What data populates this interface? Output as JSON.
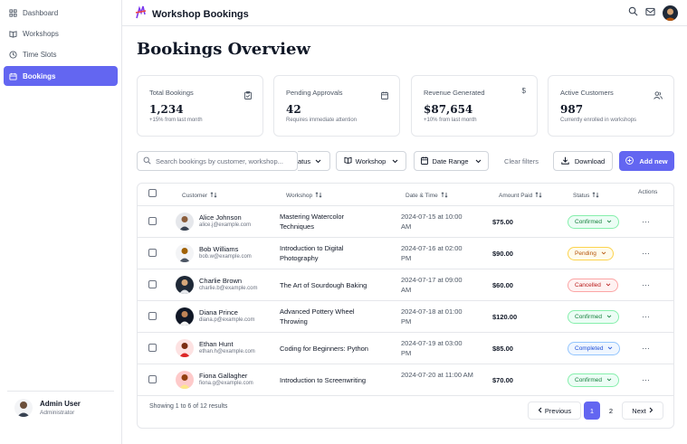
{
  "sidebar": {
    "items": [
      {
        "label": "Dashboard",
        "icon": "grid-icon"
      },
      {
        "label": "Workshops",
        "icon": "book-icon"
      },
      {
        "label": "Time Slots",
        "icon": "clock-icon"
      },
      {
        "label": "Bookings",
        "icon": "calendar-icon",
        "active": true
      }
    ],
    "user": {
      "name": "Admin User",
      "role": "Administrator"
    }
  },
  "header": {
    "title": "Workshop Bookings",
    "icons": [
      "search-icon",
      "mail-icon",
      "avatar"
    ]
  },
  "page": {
    "title": "Bookings Overview"
  },
  "stats": [
    {
      "label": "Total Bookings",
      "value": "1,234",
      "sub": "+15% from last month",
      "icon": "clipboard-icon"
    },
    {
      "label": "Pending Approvals",
      "value": "42",
      "sub": "Requires immediate attention",
      "icon": "calendar-icon"
    },
    {
      "label": "Revenue Generated",
      "value": "$87,654",
      "sub": "+10% from last month",
      "icon": "dollar-icon"
    },
    {
      "label": "Active Customers",
      "value": "987",
      "sub": "Currently enrolled in workshops",
      "icon": "users-icon"
    }
  ],
  "filters": {
    "search_placeholder": "Search bookings by customer, workshop...",
    "status_label": "atus",
    "workshop_label": "Workshop",
    "date_range_label": "Date Range",
    "clear_label": "Clear filters",
    "download_label": "Download",
    "add_label": "Add new"
  },
  "table": {
    "headers": {
      "customer": "Customer",
      "workshop": "Workshop",
      "datetime": "Date & Time",
      "amount": "Amount Paid",
      "status": "Status",
      "actions": "Actions"
    },
    "rows": [
      {
        "name": "Alice Johnson",
        "email": "alice.j@example.com",
        "workshop": "Mastering Watercolor Techniques",
        "datetime": "2024-07-15 at 10:00 AM",
        "amount": "$75.00",
        "status": "Confirmed",
        "status_key": "confirmed",
        "avatar_color": "#d1d5db"
      },
      {
        "name": "Bob Williams",
        "email": "bob.w@example.com",
        "workshop": "Introduction to Digital Photography",
        "datetime": "2024-07-16 at 02:00 PM",
        "amount": "$90.00",
        "status": "Pending",
        "status_key": "pending",
        "avatar_color": "#e5e7eb"
      },
      {
        "name": "Charlie Brown",
        "email": "charlie.b@example.com",
        "workshop": "The Art of Sourdough Baking",
        "datetime": "2024-07-17 at 09:00 AM",
        "amount": "$60.00",
        "status": "Cancelled",
        "status_key": "cancelled",
        "avatar_color": "#1f2937"
      },
      {
        "name": "Diana Prince",
        "email": "diana.p@example.com",
        "workshop": "Advanced Pottery Wheel Throwing",
        "datetime": "2024-07-18 at 01:00 PM",
        "amount": "$120.00",
        "status": "Confirmed",
        "status_key": "confirmed",
        "avatar_color": "#111827"
      },
      {
        "name": "Ethan Hunt",
        "email": "ethan.h@example.com",
        "workshop": "Coding for Beginners: Python",
        "datetime": "2024-07-19 at 03:00 PM",
        "amount": "$85.00",
        "status": "Completed",
        "status_key": "completed",
        "avatar_color": "#fde2e2"
      },
      {
        "name": "Fiona Gallagher",
        "email": "fiona.g@example.com",
        "workshop": "Introduction to Screenwriting",
        "datetime": "2024-07-20 at 11:00 AM",
        "amount": "$70.00",
        "status": "Confirmed",
        "status_key": "confirmed",
        "avatar_color": "#fecaca"
      }
    ],
    "footer": {
      "showing": "Showing 1 to 6 of 12 results"
    }
  },
  "pagination": {
    "previous": "Previous",
    "pages": [
      "1",
      "2"
    ],
    "next": "Next"
  },
  "colors": {
    "accent": "#6366f1"
  }
}
